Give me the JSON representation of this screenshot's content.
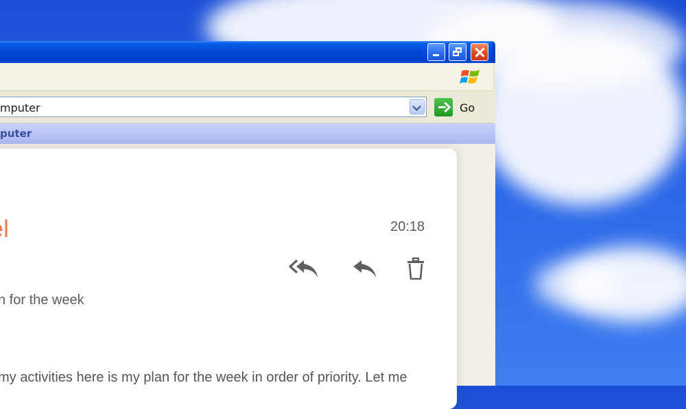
{
  "desktop": {
    "sky_color": "#2a66e6"
  },
  "window": {
    "titlebar": {
      "buttons": [
        "minimize",
        "maximize",
        "close"
      ],
      "close_color": "#df4a22"
    },
    "address_bar": {
      "value": "mputer",
      "go_label": "Go"
    },
    "location_bar": {
      "text": "puter"
    }
  },
  "email": {
    "sender": "tel",
    "time": "20:18",
    "subject": "n for the week",
    "body": "my activities here is my plan for the week in order of priority. Let me",
    "actions": {
      "reply_all_icon": "reply-all-icon",
      "reply_icon": "reply-icon",
      "delete_icon": "trash-icon"
    },
    "accent_color": "#f17a52"
  }
}
